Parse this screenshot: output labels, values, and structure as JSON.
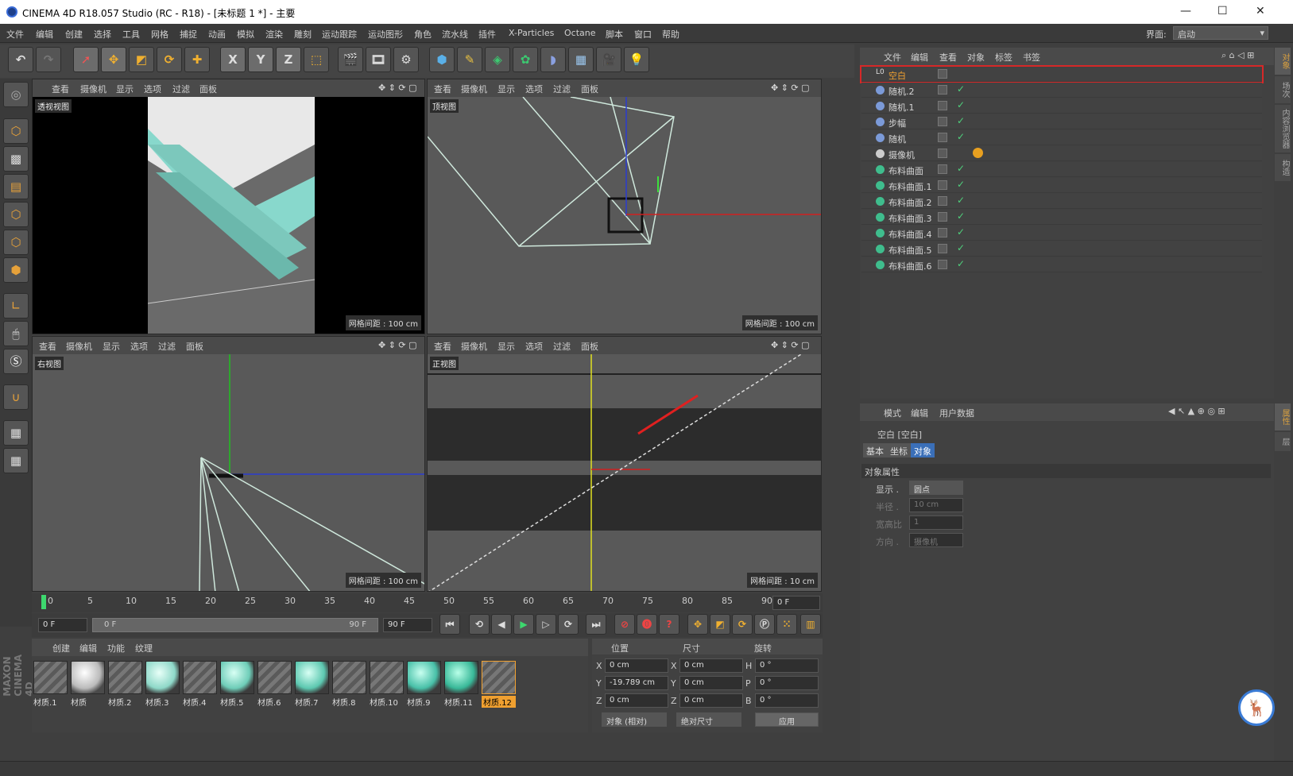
{
  "window": {
    "title": "CINEMA 4D R18.057 Studio (RC - R18) - [未标题 1 *] - 主要",
    "min": "—",
    "max": "☐",
    "close": "✕"
  },
  "menu": [
    "文件",
    "编辑",
    "创建",
    "选择",
    "工具",
    "网格",
    "捕捉",
    "动画",
    "模拟",
    "渲染",
    "雕刻",
    "运动跟踪",
    "运动图形",
    "角色",
    "流水线",
    "插件",
    "X-Particles",
    "Octane",
    "脚本",
    "窗口",
    "帮助"
  ],
  "layout": {
    "label": "界面:",
    "value": "启动"
  },
  "toolbar": {
    "x": "X",
    "y": "Y",
    "z": "Z"
  },
  "viewports": [
    {
      "menu": [
        "查看",
        "摄像机",
        "显示",
        "选项",
        "过滤",
        "面板"
      ],
      "label": "透视视图",
      "grid": ""
    },
    {
      "menu": [
        "查看",
        "摄像机",
        "显示",
        "选项",
        "过滤",
        "面板"
      ],
      "label": "顶视图",
      "grid": "网格间距 : 100 cm"
    },
    {
      "menu": [
        "查看",
        "摄像机",
        "显示",
        "选项",
        "过滤",
        "面板"
      ],
      "label": "右视图",
      "grid": "网格间距 : 100 cm"
    },
    {
      "menu": [
        "查看",
        "摄像机",
        "显示",
        "选项",
        "过滤",
        "面板"
      ],
      "label": "正视图",
      "grid": "网格间距 : 10 cm"
    }
  ],
  "persp_grid": "网格间距 : 100 cm",
  "timeline": {
    "ticks": [
      "0",
      "5",
      "10",
      "15",
      "20",
      "25",
      "30",
      "35",
      "40",
      "45",
      "50",
      "55",
      "60",
      "65",
      "70",
      "75",
      "80",
      "85",
      "90"
    ],
    "current": "0 F"
  },
  "transport": {
    "start": "0 F",
    "range_start": "0 F",
    "range_end": "90 F",
    "end": "90 F"
  },
  "materials": {
    "menu": [
      "创建",
      "编辑",
      "功能",
      "纹理"
    ],
    "items": [
      "材质.1",
      "材质",
      "材质.2",
      "材质.3",
      "材质.4",
      "材质.5",
      "材质.6",
      "材质.7",
      "材质.8",
      "材质.10",
      "材质.9",
      "材质.11",
      "材质.12"
    ]
  },
  "coords": {
    "headers": [
      "位置",
      "尺寸",
      "旋转"
    ],
    "rows": [
      {
        "a": "X",
        "av": "0 cm",
        "b": "X",
        "bv": "0 cm",
        "c": "H",
        "cv": "0 °"
      },
      {
        "a": "Y",
        "av": "-19.789 cm",
        "b": "Y",
        "bv": "0 cm",
        "c": "P",
        "cv": "0 °"
      },
      {
        "a": "Z",
        "av": "0 cm",
        "b": "Z",
        "bv": "0 cm",
        "c": "B",
        "cv": "0 °"
      }
    ],
    "mode": "对象 (相对)",
    "size_mode": "绝对尺寸",
    "apply": "应用"
  },
  "objects": {
    "menu": [
      "文件",
      "编辑",
      "查看",
      "对象",
      "标签",
      "书签"
    ],
    "items": [
      "空白",
      "随机.2",
      "随机.1",
      "步幅",
      "随机",
      "摄像机",
      "布料曲面",
      "布料曲面.1",
      "布料曲面.2",
      "布料曲面.3",
      "布料曲面.4",
      "布料曲面.5",
      "布料曲面.6"
    ]
  },
  "attributes": {
    "menu": [
      "模式",
      "编辑",
      "用户数据"
    ],
    "title": "空白 [空白]",
    "tabs": [
      "基本",
      "坐标",
      "对象"
    ],
    "section": "对象属性",
    "fields": [
      {
        "label": "显示 .",
        "value": "圆点"
      },
      {
        "label": "半径 .",
        "value": "10 cm"
      },
      {
        "label": "宽高比",
        "value": "1"
      },
      {
        "label": "方向 .",
        "value": "摄像机"
      }
    ]
  },
  "side_tabs": [
    "对象",
    "场次",
    "内容浏览器",
    "构造"
  ],
  "side_tabs2": [
    "属性",
    "层"
  ],
  "brand": "MAXON CINEMA 4D"
}
